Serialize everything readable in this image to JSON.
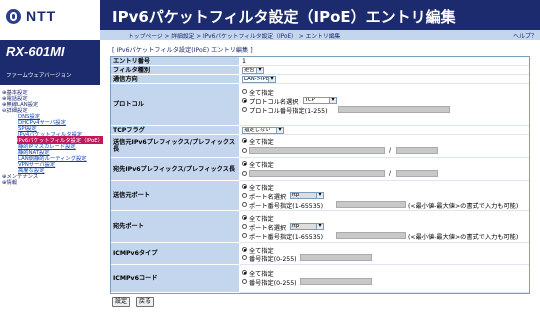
{
  "brand": {
    "logo": "NTT",
    "model": "RX-601MI",
    "firmware_label": "ファームウェアバージョン"
  },
  "header": {
    "title": "IPv6パケットフィルタ設定（IPoE）エントリ編集"
  },
  "breadcrumb": {
    "items": [
      "トップページ",
      "詳細設定",
      "IPv6パケットフィルタ設定（IPoE）",
      "エントリ編集"
    ],
    "sep": " > "
  },
  "help": "ヘルプ？",
  "nav": {
    "items": [
      {
        "label": "基本設定"
      },
      {
        "label": "電話設定"
      },
      {
        "label": "無線LAN設定"
      },
      {
        "label": "詳細設定"
      },
      {
        "label": "DNS設定"
      },
      {
        "label": "DHCPv4サーバ設定"
      },
      {
        "label": "SPI設定"
      },
      {
        "label": "IPv4パケットフィルタ設定"
      },
      {
        "label": "IPv6パケットフィルタ設定（IPoE）"
      },
      {
        "label": "静的IPマスカレード設定"
      },
      {
        "label": "静的NAT設定"
      },
      {
        "label": "LAN側静的ルーティング設定"
      },
      {
        "label": "VPNサーバ設定"
      },
      {
        "label": "高度な設定"
      },
      {
        "label": "メンテナンス"
      },
      {
        "label": "情報"
      }
    ]
  },
  "form": {
    "section_title": "[ IPv6パケットフィルタ設定(IPoE) エントリ編集 ]",
    "entry_no": {
      "label": "エントリ番号",
      "value": "1"
    },
    "filter_type": {
      "label": "フィルタ種別",
      "value": "拒否"
    },
    "direction": {
      "label": "通信方向",
      "value": "LAN->IPoE"
    },
    "protocol": {
      "label": "プロトコル",
      "opt_all": "全て指定",
      "opt_name": "プロトコル名選択",
      "name_value": "TCP",
      "opt_num": "プロトコル番号指定(1-255)"
    },
    "tcp_flag": {
      "label": "TCPフラグ",
      "value": "指定しない"
    },
    "src_prefix": {
      "label": "送信元IPv6プレフィックス/プレフィックス長",
      "opt_all": "全て指定",
      "slash": "/"
    },
    "dst_prefix": {
      "label": "宛先IPv6プレフィックス/プレフィックス長",
      "opt_all": "全て指定",
      "slash": "/"
    },
    "src_port": {
      "label": "送信元ポート",
      "opt_all": "全て指定",
      "opt_name": "ポート名選択",
      "name_value": "ftp",
      "opt_num": "ポート番号指定(1-65535)",
      "hint": "(<最小値-最大値>の書式で入力も可能)"
    },
    "dst_port": {
      "label": "宛先ポート",
      "opt_all": "全て指定",
      "opt_name": "ポート名選択",
      "name_value": "ftp",
      "opt_num": "ポート番号指定(1-65535)",
      "hint": "(<最小値-最大値>の書式で入力も可能)"
    },
    "icmp_type": {
      "label": "ICMPv6タイプ",
      "opt_all": "全て指定",
      "opt_num": "番号指定(0-255)"
    },
    "icmp_code": {
      "label": "ICMPv6コード",
      "opt_all": "全て指定",
      "opt_num": "番号指定(0-255)"
    }
  },
  "buttons": {
    "set": "設定",
    "back": "戻る"
  }
}
